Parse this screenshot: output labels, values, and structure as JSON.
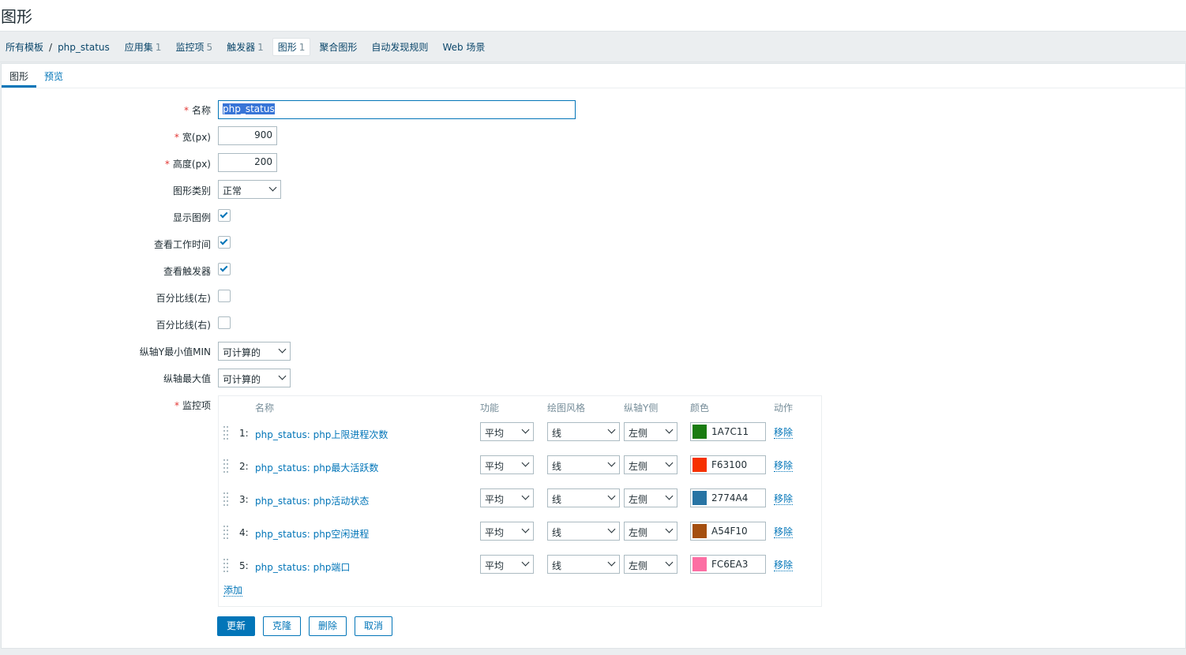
{
  "page": {
    "title": "图形"
  },
  "nav": {
    "all_templates": "所有模板",
    "template": "php_status",
    "items": [
      {
        "label": "应用集",
        "count": "1"
      },
      {
        "label": "监控项",
        "count": "5"
      },
      {
        "label": "触发器",
        "count": "1"
      },
      {
        "label": "图形",
        "count": "1"
      },
      {
        "label": "聚合图形",
        "count": ""
      },
      {
        "label": "自动发现规则",
        "count": ""
      },
      {
        "label": "Web 场景",
        "count": ""
      }
    ]
  },
  "tabs": [
    {
      "label": "图形"
    },
    {
      "label": "预览"
    }
  ],
  "form": {
    "required_mark": "*",
    "name_label": "名称",
    "name_value": "php_status",
    "width_label": "宽(px)",
    "width_value": "900",
    "height_label": "高度(px)",
    "height_value": "200",
    "graph_type_label": "图形类别",
    "graph_type_value": "正常",
    "show_legend_label": "显示图例",
    "show_legend_checked": true,
    "show_work_period_label": "查看工作时间",
    "show_work_period_checked": true,
    "show_triggers_label": "查看触发器",
    "show_triggers_checked": true,
    "percent_left_label": "百分比线(左)",
    "percent_left_checked": false,
    "percent_right_label": "百分比线(右)",
    "percent_right_checked": false,
    "ymin_label": "纵轴Y最小值MIN",
    "ymin_value": "可计算的",
    "ymax_label": "纵轴最大值",
    "ymax_value": "可计算的",
    "items_label": "监控项"
  },
  "items_table": {
    "headers": {
      "name": "名称",
      "function": "功能",
      "draw_style": "绘图风格",
      "y_axis_side": "纵轴Y侧",
      "color": "颜色",
      "action": "动作"
    },
    "rows": [
      {
        "num": "1:",
        "name": "php_status: php上限进程次数",
        "function": "平均",
        "draw_style": "线",
        "y_axis_side": "左侧",
        "color": "1A7C11",
        "color_hex": "#1A7C11",
        "remove": "移除"
      },
      {
        "num": "2:",
        "name": "php_status: php最大活跃数",
        "function": "平均",
        "draw_style": "线",
        "y_axis_side": "左侧",
        "color": "F63100",
        "color_hex": "#F63100",
        "remove": "移除"
      },
      {
        "num": "3:",
        "name": "php_status: php活动状态",
        "function": "平均",
        "draw_style": "线",
        "y_axis_side": "左侧",
        "color": "2774A4",
        "color_hex": "#2774A4",
        "remove": "移除"
      },
      {
        "num": "4:",
        "name": "php_status: php空闲进程",
        "function": "平均",
        "draw_style": "线",
        "y_axis_side": "左侧",
        "color": "A54F10",
        "color_hex": "#A54F10",
        "remove": "移除"
      },
      {
        "num": "5:",
        "name": "php_status: php端口",
        "function": "平均",
        "draw_style": "线",
        "y_axis_side": "左侧",
        "color": "FC6EA3",
        "color_hex": "#FC6EA3",
        "remove": "移除"
      }
    ],
    "add_label": "添加"
  },
  "buttons": {
    "update": "更新",
    "clone": "克隆",
    "delete": "删除",
    "cancel": "取消"
  },
  "colors": {
    "accent": "#0275b8",
    "required": "#e33734",
    "link": "#0275b8"
  }
}
